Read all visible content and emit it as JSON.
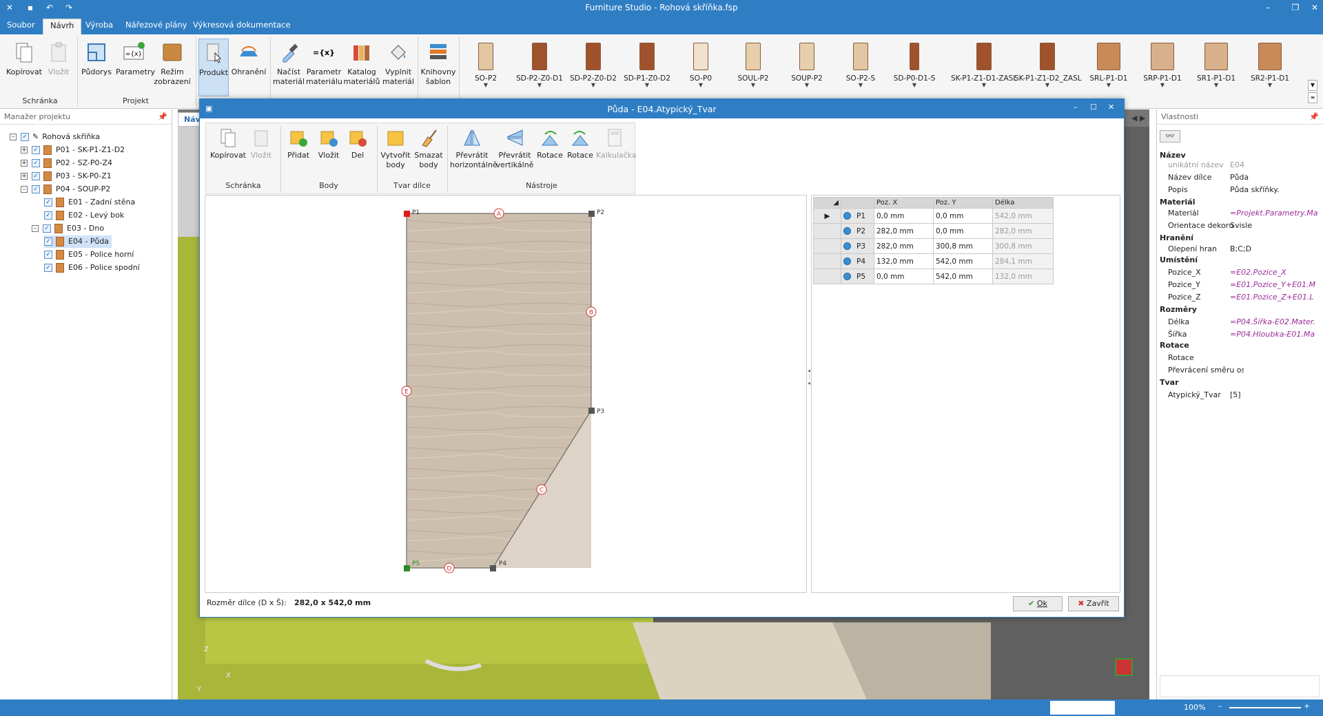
{
  "window": {
    "title": "Furniture Studio - Rohová skříňka.fsp"
  },
  "menu": {
    "tabs": [
      "Soubor",
      "Návrh",
      "Výroba",
      "Nářezové plány",
      "Výkresová dokumentace"
    ],
    "active": "Návrh"
  },
  "ribbon": {
    "buttons": {
      "kopirovat": "Kopírovat",
      "vlozit": "Vložit",
      "pudorys": "Půdorys",
      "parametry": "Parametry",
      "parametry_badge": "15",
      "rezim_zobrazeni": "Režim zobrazení",
      "produkt": "Produkt",
      "ohraneni": "Ohranění",
      "nacist_material": "Načíst materiál",
      "parametr_materialu": "Parametr materiálu",
      "katalog_materialu": "Katalog materiálů",
      "vyplnit_material": "Vyplnit materiál",
      "knihovny_sablon": "Knihovny šablon"
    },
    "groups": {
      "schranka": "Schránka",
      "projekt": "Projekt"
    },
    "cabinets": [
      "SO-P2",
      "SD-P2-Z0-D1",
      "SD-P2-Z0-D2",
      "SD-P1-Z0-D2",
      "SO-P0",
      "SOUL-P2",
      "SOUP-P2",
      "SO-P2-S",
      "SD-P0-D1-S",
      "SK-P1-Z1-D1-ZASL",
      "SK-P1-Z1-D2_ZASL",
      "SRL-P1-D1",
      "SRP-P1-D1",
      "SR1-P1-D1",
      "SR2-P1-D1"
    ]
  },
  "project_manager": {
    "title": "Manažer projektu",
    "root": "Rohová skříňka",
    "items": [
      "P01 - SK-P1-Z1-D2",
      "P02 - SZ-P0-Z4",
      "P03 - SK-P0-Z1",
      "P04 - SOUP-P2"
    ],
    "children": [
      "E01 - Zadní stěna",
      "E02 - Levý bok",
      "E03 - Dno",
      "E04 - Půda",
      "E05 - Police horní",
      "E06 - Police spodní"
    ],
    "selected": "E04 - Půda"
  },
  "viewport": {
    "tab": "Návrh",
    "axes": {
      "z": "Z",
      "x": "X",
      "y": "Y"
    }
  },
  "properties": {
    "title": "Vlastnosti",
    "rows": [
      {
        "k": "Název",
        "v": "",
        "cat": true
      },
      {
        "k": "unikátní název",
        "v": "E04",
        "gray": true
      },
      {
        "k": "Název dílce",
        "v": "Půda"
      },
      {
        "k": "Popis",
        "v": "Půda skříňky."
      },
      {
        "k": "Materiál",
        "v": "",
        "cat": true
      },
      {
        "k": "Materiál",
        "v": "=Projekt.Parametry.Ma",
        "f": true
      },
      {
        "k": "Orientace dekoru",
        "v": "Svisle"
      },
      {
        "k": "Hranění",
        "v": "",
        "cat": true
      },
      {
        "k": "Olepení hran",
        "v": "B;C;D"
      },
      {
        "k": "Umístění",
        "v": "",
        "cat": true
      },
      {
        "k": "Pozice_X",
        "v": "=E02.Pozice_X",
        "f": true
      },
      {
        "k": "Pozice_Y",
        "v": "=E01.Pozice_Y+E01.M",
        "f": true
      },
      {
        "k": "Pozice_Z",
        "v": "=E01.Pozice_Z+E01.L",
        "f": true
      },
      {
        "k": "Rozměry",
        "v": "",
        "cat": true
      },
      {
        "k": "Délka",
        "v": "=P04.Šířka-E02.Mater.",
        "f": true
      },
      {
        "k": "Šířka",
        "v": "=P04.Hloubka-E01.Ma",
        "f": true
      },
      {
        "k": "Rotace",
        "v": "",
        "cat": true
      },
      {
        "k": "Rotace",
        "v": ""
      },
      {
        "k": "Převrácení směru os",
        "v": ""
      },
      {
        "k": "Tvar",
        "v": "",
        "cat": true
      },
      {
        "k": "Atypický_Tvar",
        "v": "[5]"
      }
    ]
  },
  "status": {
    "zoom": "100%"
  },
  "dialog": {
    "title": "Půda - E04.Atypický_Tvar",
    "buttons": {
      "kopirovat": "Kopírovat",
      "vlozit": "Vložit",
      "pridat": "Přidat",
      "vlozit_bod": "Vložit",
      "del": "Del",
      "vytvorit_body": "Vytvořit body",
      "smazat_body": "Smazat body",
      "prevratit_h": "Převrátit horizontálně",
      "prevratit_v": "Převrátit vertikálně",
      "rotace1": "Rotace",
      "rotace2": "Rotace",
      "kalkulacka": "Kalkulačka"
    },
    "groups": {
      "schranka": "Schránka",
      "body": "Body",
      "tvar": "Tvar dílce",
      "nastroje": "Nástroje"
    },
    "edges": [
      "A",
      "B",
      "C",
      "D",
      "E"
    ],
    "point_labels": [
      "P1",
      "P2",
      "P3",
      "P4",
      "P5"
    ],
    "table": {
      "headers": [
        "Poz. X",
        "Poz. Y",
        "Délka"
      ],
      "rows": [
        {
          "p": "P1",
          "x": "0,0 mm",
          "y": "0,0 mm",
          "d": "542,0 mm"
        },
        {
          "p": "P2",
          "x": "282,0 mm",
          "y": "0,0 mm",
          "d": "282,0 mm"
        },
        {
          "p": "P3",
          "x": "282,0 mm",
          "y": "300,8 mm",
          "d": "300,8 mm"
        },
        {
          "p": "P4",
          "x": "132,0 mm",
          "y": "542,0 mm",
          "d": "284,1 mm"
        },
        {
          "p": "P5",
          "x": "0,0 mm",
          "y": "542,0 mm",
          "d": "132,0 mm"
        }
      ]
    },
    "size_label": "Rozměr dílce (D x Š):",
    "size_value": "282,0 x 542,0 mm",
    "ok": "Ok",
    "close": "Zavřít"
  }
}
